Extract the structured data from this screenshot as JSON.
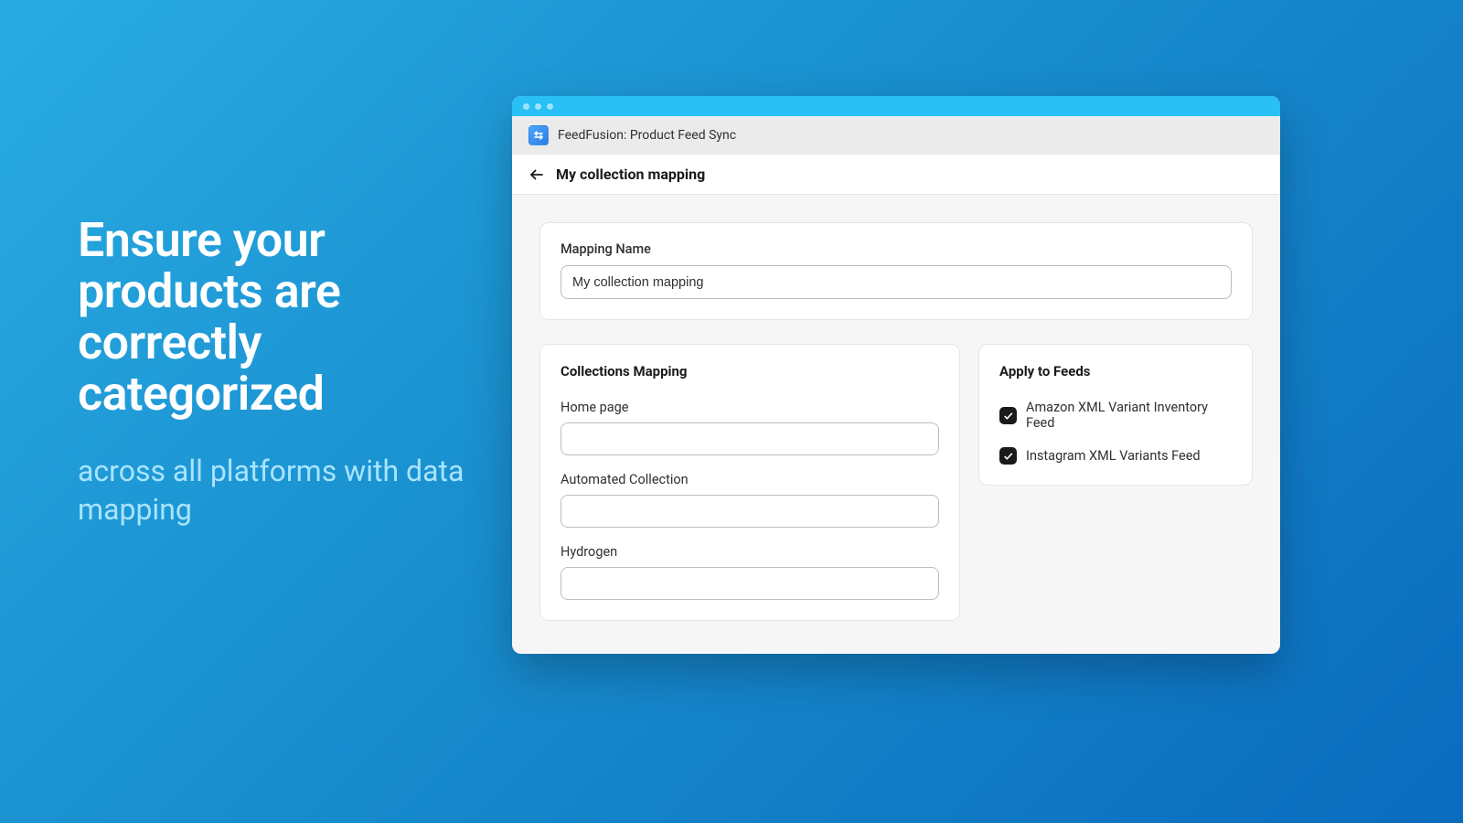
{
  "marketing": {
    "headline": "Ensure your products are correctly categorized",
    "subline": "across all platforms with data mapping"
  },
  "app": {
    "title": "FeedFusion: Product Feed Sync"
  },
  "page": {
    "title": "My collection mapping"
  },
  "mapping_name": {
    "label": "Mapping Name",
    "value": "My collection mapping"
  },
  "collections": {
    "title": "Collections Mapping",
    "items": [
      {
        "label": "Home page",
        "value": ""
      },
      {
        "label": "Automated Collection",
        "value": ""
      },
      {
        "label": "Hydrogen",
        "value": ""
      }
    ]
  },
  "feeds": {
    "title": "Apply to Feeds",
    "items": [
      {
        "label": "Amazon XML Variant Inventory Feed",
        "checked": true
      },
      {
        "label": "Instagram XML Variants Feed",
        "checked": true
      }
    ]
  }
}
